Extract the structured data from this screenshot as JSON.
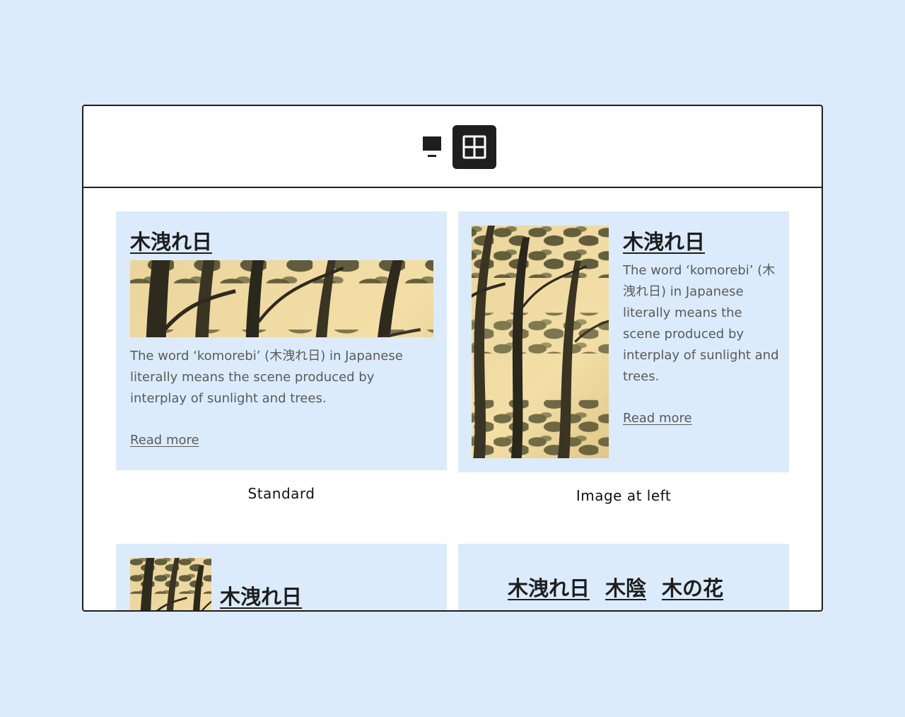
{
  "toolbar": {
    "single_view_icon": "single-column-icon",
    "grid_view_icon": "grid-icon"
  },
  "cards": [
    {
      "title": "木洩れ日",
      "excerpt": "The word ‘komorebi’ (木洩れ日) in Japanese literally means the scene produced by interplay of sunlight and trees.",
      "read_more": "Read more",
      "caption": "Standard"
    },
    {
      "title": "木洩れ日",
      "excerpt": "The word ‘komorebi’ (木洩れ日) in Japanese literally means the scene produced by interplay of sunlight and trees.",
      "read_more": "Read more",
      "caption": "Image at left"
    },
    {
      "title": "木洩れ日"
    },
    {
      "tags": [
        "木洩れ日",
        "木陰",
        "木の花"
      ]
    }
  ],
  "colors": {
    "page_bg": "#dcebfb",
    "card_bg": "#dcebfb",
    "border": "#1e1e1e",
    "active_button": "#1e1e1e",
    "muted_text": "#5a5a5a"
  }
}
